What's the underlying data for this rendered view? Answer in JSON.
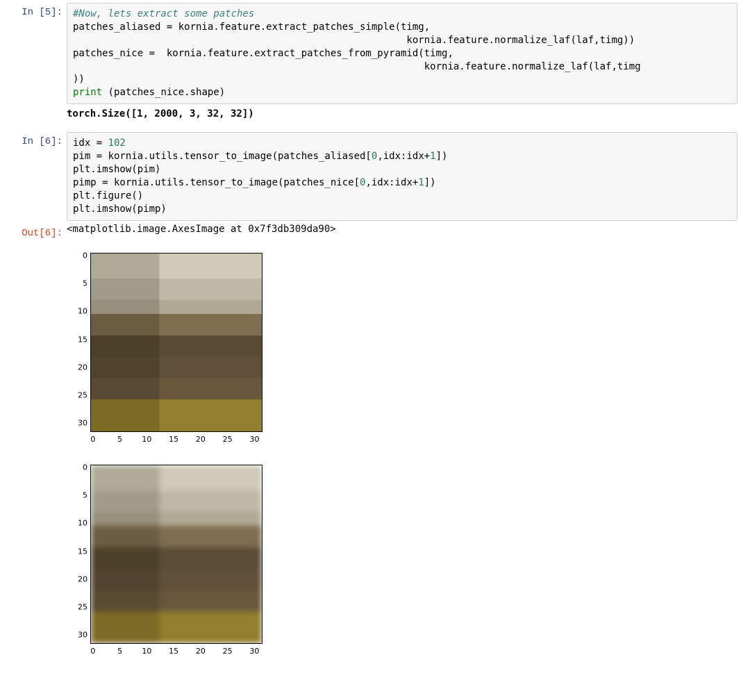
{
  "cells": {
    "c5": {
      "in_label": "In [5]:",
      "comment": "#Now, lets extract some patches",
      "l1": "patches_aliased = kornia.feature.extract_patches_simple(timg,",
      "l2": "                                                         kornia.feature.normalize_laf(laf,timg))",
      "l3": "patches_nice =  kornia.feature.extract_patches_from_pyramid(timg,",
      "l4": "                                                            kornia.feature.normalize_laf(laf,timg",
      "l5": "))",
      "print_kw": "print",
      "print_arg": " (patches_nice.shape)",
      "stdout": "torch.Size([1, 2000, 3, 32, 32])"
    },
    "c6": {
      "in_label": "In [6]:",
      "l1a": "idx = ",
      "l1num": "102",
      "l2a": "pim = kornia.utils.tensor_to_image(patches_aliased[",
      "l2b": "0",
      "l2c": ",idx:idx+",
      "l2d": "1",
      "l2e": "])",
      "l3": "plt.imshow(pim)",
      "l4a": "pimp = kornia.utils.tensor_to_image(patches_nice[",
      "l4b": "0",
      "l4c": ",idx:idx+",
      "l4d": "1",
      "l4e": "])",
      "l5": "plt.figure()",
      "l6": "plt.imshow(pimp)",
      "out_label": "Out[6]:",
      "repr": "<matplotlib.image.AxesImage at 0x7f3db309da90>"
    }
  },
  "chart_data": [
    {
      "type": "image",
      "description": "imshow of patches_aliased[0,102] (32x32 RGB patch, heavy aliasing / pixelation)",
      "x_ticks": [
        0,
        5,
        10,
        15,
        20,
        25,
        30
      ],
      "y_ticks": [
        0,
        5,
        10,
        15,
        20,
        25,
        30
      ],
      "xlim": [
        -0.5,
        31.5
      ],
      "ylim": [
        31.5,
        -0.5
      ]
    },
    {
      "type": "image",
      "description": "imshow of patches_nice[0,102] (32x32 RGB patch, from image pyramid, smoother)",
      "x_ticks": [
        0,
        5,
        10,
        15,
        20,
        25,
        30
      ],
      "y_ticks": [
        0,
        5,
        10,
        15,
        20,
        25,
        30
      ],
      "xlim": [
        -0.5,
        31.5
      ],
      "ylim": [
        31.5,
        -0.5
      ]
    }
  ]
}
